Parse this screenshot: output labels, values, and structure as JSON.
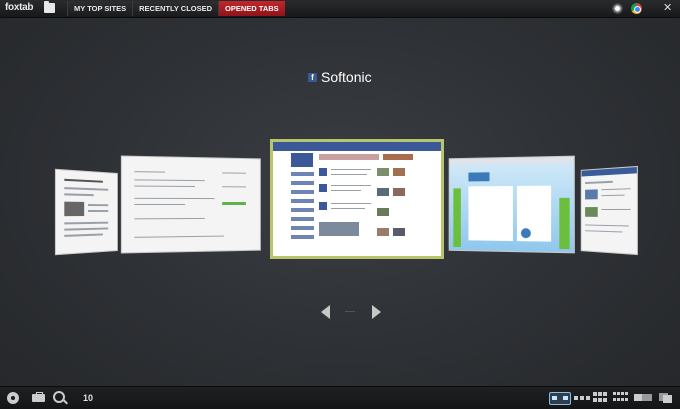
{
  "app": {
    "logo": "foxtab"
  },
  "tabs": [
    {
      "label": "MY TOP SITES",
      "active": false
    },
    {
      "label": "RECENTLY CLOSED",
      "active": false
    },
    {
      "label": "OPENED TABS",
      "active": true
    }
  ],
  "topright": {
    "close_label": "✕"
  },
  "current": {
    "title": "Softonic",
    "favicon_letter": "f"
  },
  "colors": {
    "accent": "#c1272d",
    "selected_border": "#b8c56b",
    "facebook": "#3b5998"
  },
  "thumbnails": [
    {
      "name": "thumbnail-news-site"
    },
    {
      "name": "thumbnail-document"
    },
    {
      "name": "thumbnail-facebook"
    },
    {
      "name": "thumbnail-foxtab-site"
    },
    {
      "name": "thumbnail-web-page"
    }
  ],
  "bottombar": {
    "count": "10"
  },
  "icons": [
    "folder-icon",
    "firefox-icon",
    "chrome-icon",
    "close-icon",
    "gear-icon",
    "toolbox-icon",
    "search-icon",
    "carousel-view-icon",
    "row-view-icon",
    "grid-view-icon",
    "small-grid-view-icon",
    "perspective-view-icon",
    "stack-view-icon"
  ]
}
